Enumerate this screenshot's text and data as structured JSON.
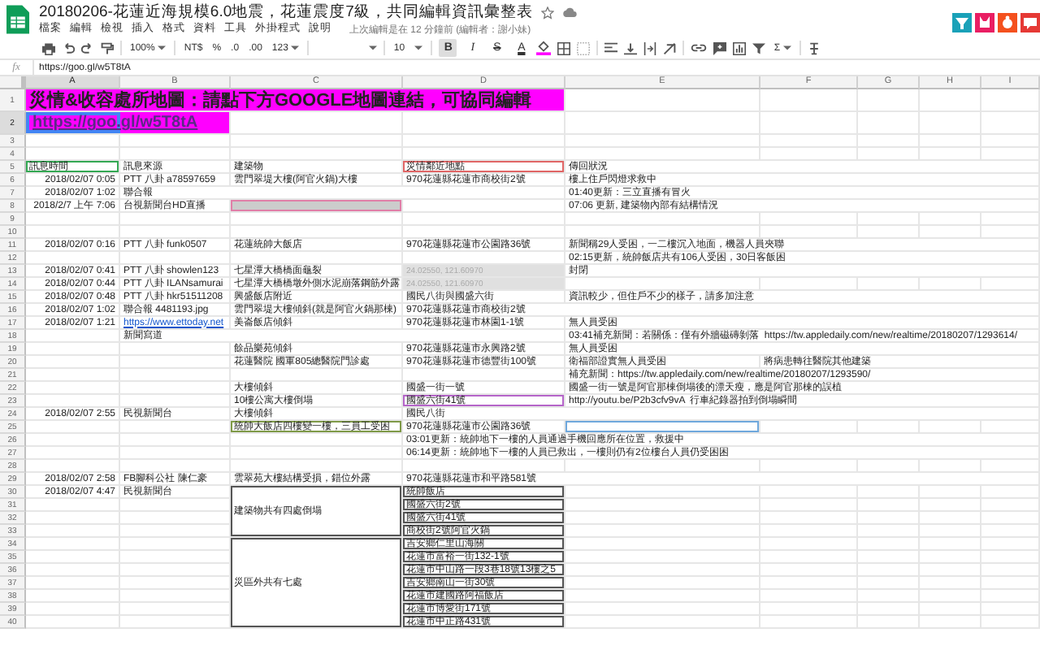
{
  "title": "20180206-花蓮近海規模6.0地震，花蓮震度7級，共同編輯資訊彙整表",
  "menu": [
    "檔案",
    "編輯",
    "檢視",
    "插入",
    "格式",
    "資料",
    "工具",
    "外掛程式",
    "說明"
  ],
  "last_edit": "上次編輯是在 12 分鐘前 (編輯者：謝小妹)",
  "toolbar": {
    "zoom": "100%",
    "buttons": [
      {
        "label": "NT$",
        "kind": "plain"
      },
      {
        "label": "%",
        "kind": "plain"
      },
      {
        "label": ".0",
        "kind": "plain"
      },
      {
        "label": ".00",
        "kind": "plain"
      },
      {
        "label": "123",
        "kind": "dropdown"
      }
    ],
    "font_size": "10",
    "styles": [
      {
        "label": "B",
        "kind": "bold",
        "selected": true
      },
      {
        "label": "I",
        "kind": "italic",
        "selected": false
      },
      {
        "label": "S",
        "kind": "strike",
        "selected": false
      },
      {
        "label": "A",
        "kind": "color",
        "selected": false
      }
    ],
    "sum": "Σ"
  },
  "formula": {
    "label": "fx",
    "value": "https://goo.gl/w5T8tA"
  },
  "sheet": {
    "columns": [
      "A",
      "B",
      "C",
      "D",
      "E",
      "F",
      "G",
      "H",
      "I"
    ],
    "rows": [
      {
        "n": "1",
        "A": {
          "text": "災情&收容處所地圖：請點下方GOOGLE地圖連結，可協同編輯",
          "fill": {
            "color": "#ff00ff"
          },
          "kind": "banner"
        },
        "B": {
          "merged_left": true
        },
        "C": {
          "merged_left": true
        },
        "D": {
          "merged_left": true
        }
      },
      {
        "n": "2",
        "A": {
          "text": "https://goo.gl/w5T8tA",
          "fill": {
            "color": "#ff00ff"
          },
          "kind": "banner_link",
          "selected": true
        },
        "B": {
          "merged_left": true
        }
      },
      {
        "n": "3"
      },
      {
        "n": "4"
      },
      {
        "n": "5",
        "A": {
          "text": "訊息時間",
          "border": {
            "color": "#34a853"
          }
        },
        "B": "訊息來源",
        "C": "建築物",
        "D": {
          "text": "災情鄰近地點",
          "border": {
            "color": "#e06666"
          }
        },
        "E": "傳回狀況"
      },
      {
        "n": "6",
        "A": {
          "text": "2018/02/07 0:05",
          "kind": "date"
        },
        "B": "PTT 八卦 a78597659",
        "C": "雲門翠堤大樓(阿官火鍋)大樓",
        "D": "970花蓮縣花蓮市商校街2號",
        "E": "樓上住戶閃燈求救中"
      },
      {
        "n": "7",
        "A": {
          "text": "2018/02/07 1:02",
          "kind": "date"
        },
        "B": "聯合報",
        "E": "01:40更新：三立直播有冒火"
      },
      {
        "n": "8",
        "A": {
          "text": "2018/2/7 上午 7:06",
          "kind": "date"
        },
        "B": "台視新聞台HD直播",
        "C": {
          "fill": {
            "color": "#cccccc"
          },
          "border": {
            "color": "#e07fa8"
          }
        },
        "E": "07:06 更新, 建築物內部有結構情況"
      },
      {
        "n": "9"
      },
      {
        "n": "10"
      },
      {
        "n": "11",
        "A": {
          "text": "2018/02/07 0:16",
          "kind": "date"
        },
        "B": "PTT 八卦 funk0507",
        "C": "花蓮統帥大飯店",
        "D": "970花蓮縣花蓮市公園路36號",
        "E": "新聞稱29人受困，一二樓沉入地面，機器人員夾聯"
      },
      {
        "n": "12",
        "E": "02:15更新，統帥飯店共有106人受困，30日客飯困"
      },
      {
        "n": "13",
        "A": {
          "text": "2018/02/07 0:41",
          "kind": "date"
        },
        "B": "PTT 八卦 showlen123",
        "C": "七星潭大橋橋面龜裂",
        "D": {
          "text": "24.02550, 121.60970",
          "fill": {
            "color": "#e0e0e0"
          },
          "kind": "faint"
        },
        "E": "封閉"
      },
      {
        "n": "14",
        "A": {
          "text": "2018/02/07 0:44",
          "kind": "date"
        },
        "B": "PTT 八卦 ILANsamurai",
        "C": "七星潭大橋橋墩外側水泥崩落鋼筋外露",
        "D": {
          "text": "24.02550, 121.60970",
          "fill": {
            "color": "#e0e0e0"
          },
          "kind": "faint"
        }
      },
      {
        "n": "15",
        "A": {
          "text": "2018/02/07 0:48",
          "kind": "date"
        },
        "B": "PTT 八卦 hkr51511208",
        "C": "興盛飯店附近",
        "D": "國民八街與國盛六街",
        "E": "資訊較少，但住戶不少的樣子，請多加注意"
      },
      {
        "n": "16",
        "A": {
          "text": "2018/02/07 1:02",
          "kind": "date"
        },
        "B": "聯合報 4481193.jpg",
        "C": "雲門翠堤大樓傾斜(就是阿官火鍋那棟)",
        "D": "970花蓮縣花蓮市商校街2號"
      },
      {
        "n": "17",
        "A": {
          "text": "2018/02/07 1:21",
          "kind": "date"
        },
        "B": {
          "text": "https://www.ettoday.net",
          "kind": "link"
        },
        "C": "美崙飯店傾斜",
        "D": "970花蓮縣花蓮市林園1-1號",
        "E": "無人員受困"
      },
      {
        "n": "18",
        "B": "新聞寫道",
        "E": "03:41補充新聞：若關係：僅有外牆磁磚剝落  https://tw.appledaily.com/new/realtime/20180207/1293614/"
      },
      {
        "n": "19",
        "C": "餘品樂苑傾斜",
        "D": "970花蓮縣花蓮市永興路2號",
        "E": "無人員受困"
      },
      {
        "n": "20",
        "C": "花蓮醫院 國軍805總醫院門診處",
        "D": "970花蓮縣花蓮市德豐街100號",
        "E": "衛福部證實無人員受困",
        "F": "將病患轉往醫院其他建築"
      },
      {
        "n": "21",
        "E": "補充新聞：https://tw.appledaily.com/new/realtime/20180207/1293590/"
      },
      {
        "n": "22",
        "C": "大樓傾斜",
        "D": "國盛一街一號",
        "E": "國盛一街一號是阿官那棟倒塌後的漂天瘦，應是阿官那棟的誤植"
      },
      {
        "n": "23",
        "C": "10樓公寓大樓倒塌",
        "D": {
          "text": "國盛六街41號",
          "border": {
            "color": "#b565c9"
          }
        },
        "E": "http://youtu.be/P2b3cfv9vA  行車紀錄器拍到倒塌瞬間"
      },
      {
        "n": "24",
        "A": {
          "text": "2018/02/07 2:55",
          "kind": "date"
        },
        "B": "民視新聞台",
        "C": "大樓傾斜",
        "D": "國民八街"
      },
      {
        "n": "25",
        "C": {
          "text": "統帥大飯店四樓變一樓，三員工受困",
          "border": {
            "color": "#7f9a48"
          }
        },
        "D": "970花蓮縣花蓮市公園路36號",
        "E": {
          "border": {
            "color": "#6fa8dc"
          }
        }
      },
      {
        "n": "26",
        "D": "03:01更新：統帥地下一樓的人員通過手機回應所在位置，救援中"
      },
      {
        "n": "27",
        "D": "06:14更新：統帥地下一樓的人員已救出，一樓則仍有2位樓台人員仍受困困"
      },
      {
        "n": "28"
      },
      {
        "n": "29",
        "A": {
          "text": "2018/02/07 2:58",
          "kind": "date"
        },
        "B": "FB腳科公社 陳仁豪",
        "C": "雲翠苑大樓結構受損，錯位外露",
        "D": "970花蓮縣花蓮市和平路581號"
      },
      {
        "n": "30",
        "A": {
          "text": "2018/02/07 4:47",
          "kind": "date"
        },
        "B": "民視新聞台",
        "C": {
          "text": "建築物共有四處倒塌",
          "border": {
            "color": "#555555"
          },
          "kind": "block"
        },
        "D": {
          "text": "統帥飯店",
          "border": {
            "color": "#555555"
          }
        }
      },
      {
        "n": "31",
        "D": {
          "text": "國盛六街2號",
          "border": {
            "color": "#555555"
          }
        }
      },
      {
        "n": "32",
        "D": {
          "text": "國盛六街41號",
          "border": {
            "color": "#555555"
          }
        }
      },
      {
        "n": "33",
        "D": {
          "text": "商校街2號阿官火鍋",
          "border": {
            "color": "#555555"
          }
        }
      },
      {
        "n": "34",
        "C": {
          "text": "災區外共有七處",
          "border": {
            "color": "#555555"
          },
          "kind": "block"
        },
        "D": {
          "text": "吉安鄉仁里山海關",
          "border": {
            "color": "#555555"
          }
        }
      },
      {
        "n": "35",
        "D": {
          "text": "花蓮市富裕一街132-1號",
          "border": {
            "color": "#555555"
          }
        }
      },
      {
        "n": "36",
        "D": {
          "text": "花蓮市中山路一段3巷18號13樓之5",
          "border": {
            "color": "#555555"
          }
        }
      },
      {
        "n": "37",
        "D": {
          "text": "吉安鄉南山一街30號",
          "border": {
            "color": "#555555"
          }
        }
      },
      {
        "n": "38",
        "D": {
          "text": "花蓮市建國路阿福飯店",
          "border": {
            "color": "#555555"
          }
        }
      },
      {
        "n": "39",
        "D": {
          "text": "花蓮市博愛街171號",
          "border": {
            "color": "#555555"
          }
        }
      },
      {
        "n": "40",
        "D": {
          "text": "花蓮市中正路431號",
          "border": {
            "color": "#555555"
          }
        }
      }
    ]
  }
}
